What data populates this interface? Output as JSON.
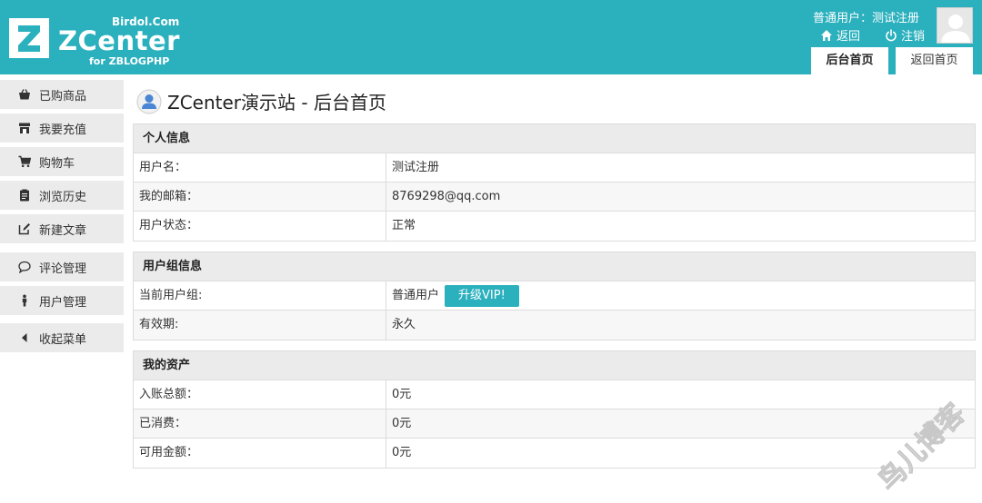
{
  "header": {
    "logo": {
      "brand_site": "Birdol.Com",
      "brand_name": "ZCenter",
      "brand_sub": "for ZBLOGPHP"
    },
    "user_line": "普通用户：测试注册",
    "back_label": "返回",
    "logout_label": "注销",
    "tabs": [
      {
        "label": "后台首页",
        "active": true
      },
      {
        "label": "返回首页",
        "active": false
      }
    ],
    "colors": {
      "brand": "#2bb0bd"
    }
  },
  "sidebar": {
    "items": [
      {
        "label": "已购商品",
        "icon": "basket-icon"
      },
      {
        "label": "我要充值",
        "icon": "store-icon"
      },
      {
        "label": "购物车",
        "icon": "cart-icon"
      },
      {
        "label": "浏览历史",
        "icon": "clipboard-icon"
      },
      {
        "label": "新建文章",
        "icon": "edit-icon"
      },
      {
        "label": "评论管理",
        "icon": "comment-icon"
      },
      {
        "label": "用户管理",
        "icon": "user-icon"
      },
      {
        "label": "收起菜单",
        "icon": "caret-left-icon"
      }
    ]
  },
  "main": {
    "title": "ZCenter演示站 - 后台首页",
    "personal": {
      "heading": "个人信息",
      "rows": [
        {
          "label": "用户名：",
          "value": "测试注册"
        },
        {
          "label": "我的邮箱：",
          "value": "8769298@qq.com"
        },
        {
          "label": "用户状态：",
          "value": "正常"
        }
      ]
    },
    "group": {
      "heading": "用户组信息",
      "rows": [
        {
          "label": "当前用户组:",
          "value": "普通用户",
          "action": "升级VIP!"
        },
        {
          "label": "有效期:",
          "value": "永久"
        }
      ]
    },
    "assets": {
      "heading": "我的资产",
      "rows": [
        {
          "label": "入账总额：",
          "value": "0元"
        },
        {
          "label": "已消费：",
          "value": "0元"
        },
        {
          "label": "可用金额：",
          "value": "0元"
        }
      ]
    }
  },
  "watermark": {
    "text": "鸟儿博客"
  }
}
